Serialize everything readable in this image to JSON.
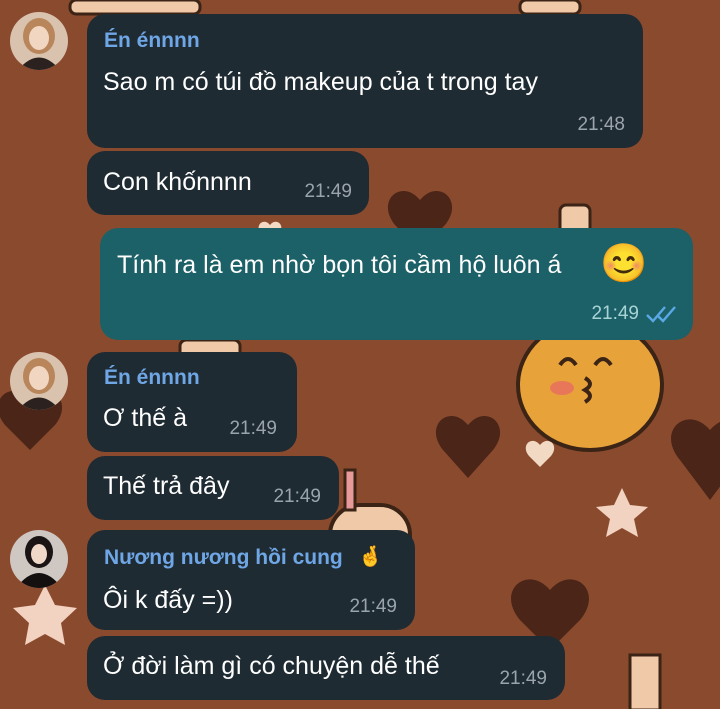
{
  "colors": {
    "background": "#8a4a2e",
    "incoming_bubble": "#1f2b33",
    "outgoing_bubble": "#1d6168",
    "sender_name": "#6fa6e6",
    "timestamp": "#9aa4ab",
    "read_check": "#5aa9e6"
  },
  "messages": [
    {
      "sender": "Én énnnn",
      "text": "Sao m có túi đồ makeup của t trong tay",
      "time": "21:48"
    },
    {
      "text": "Con khốnnnn",
      "time": "21:49"
    },
    {
      "text": "Tính ra là em nhờ bọn tôi cầm hộ luôn á",
      "emoji": "😊",
      "time": "21:49",
      "status_icon": "double-check-icon"
    },
    {
      "sender": "Én énnnn",
      "text": "Ơ thế à",
      "time": "21:49"
    },
    {
      "text": "Thế trả đây",
      "time": "21:49"
    },
    {
      "sender": "Nương nương hồi cung",
      "sender_emoji": "🤞",
      "text": "Ôi k đấy =))",
      "time": "21:49"
    },
    {
      "text": "Ở đời làm gì có chuyện dễ thế",
      "time": "21:49"
    }
  ]
}
